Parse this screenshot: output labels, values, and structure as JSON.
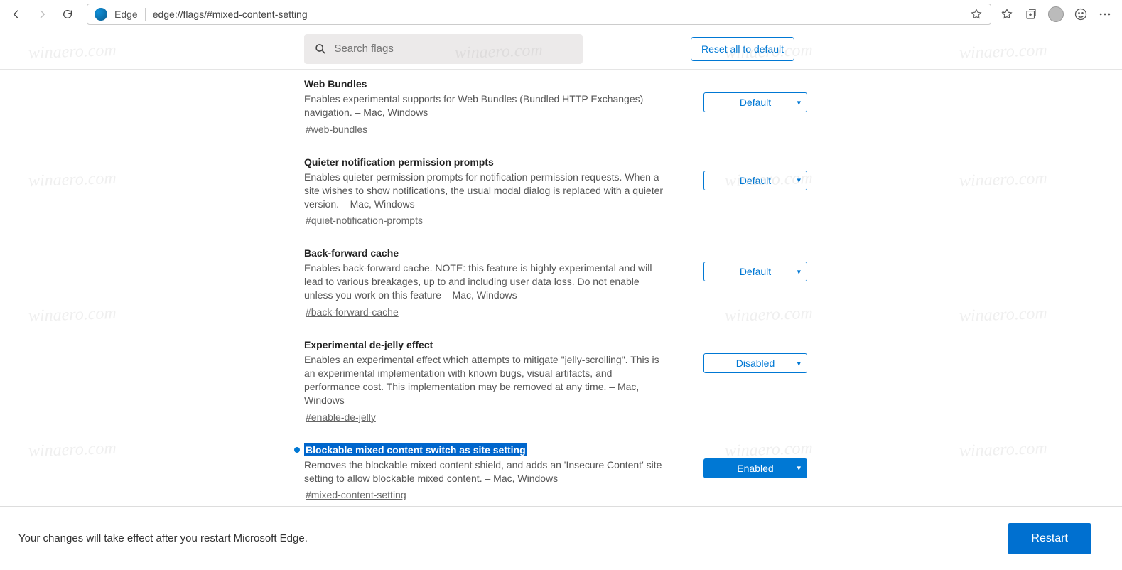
{
  "chrome": {
    "app_label": "Edge",
    "url": "edge://flags/#mixed-content-setting"
  },
  "page": {
    "search_placeholder": "Search flags",
    "reset_label": "Reset all to default"
  },
  "flags": [
    {
      "title": "Web Bundles",
      "desc": "Enables experimental supports for Web Bundles (Bundled HTTP Exchanges) navigation. – Mac, Windows",
      "link": "#web-bundles",
      "value": "Default",
      "highlight": false,
      "bullet": false,
      "enabled_style": false
    },
    {
      "title": "Quieter notification permission prompts",
      "desc": "Enables quieter permission prompts for notification permission requests. When a site wishes to show notifications, the usual modal dialog is replaced with a quieter version. – Mac, Windows",
      "link": "#quiet-notification-prompts",
      "value": "Default",
      "highlight": false,
      "bullet": false,
      "enabled_style": false
    },
    {
      "title": "Back-forward cache",
      "desc": "Enables back-forward cache. NOTE: this feature is highly experimental and will lead to various breakages, up to and including user data loss. Do not enable unless you work on this feature – Mac, Windows",
      "link": "#back-forward-cache",
      "value": "Default",
      "highlight": false,
      "bullet": false,
      "enabled_style": false
    },
    {
      "title": "Experimental de-jelly effect",
      "desc": "Enables an experimental effect which attempts to mitigate \"jelly-scrolling\". This is an experimental implementation with known bugs, visual artifacts, and performance cost. This implementation may be removed at any time. – Mac, Windows",
      "link": "#enable-de-jelly",
      "value": "Disabled",
      "highlight": false,
      "bullet": false,
      "enabled_style": false
    },
    {
      "title": "Blockable mixed content switch as site setting",
      "desc": "Removes the blockable mixed content shield, and adds an 'Insecure Content' site setting to allow blockable mixed content. – Mac, Windows",
      "link": "#mixed-content-setting",
      "value": "Enabled",
      "highlight": true,
      "bullet": true,
      "enabled_style": true
    }
  ],
  "restart": {
    "message": "Your changes will take effect after you restart Microsoft Edge.",
    "button": "Restart"
  },
  "watermark": "winaero.com"
}
